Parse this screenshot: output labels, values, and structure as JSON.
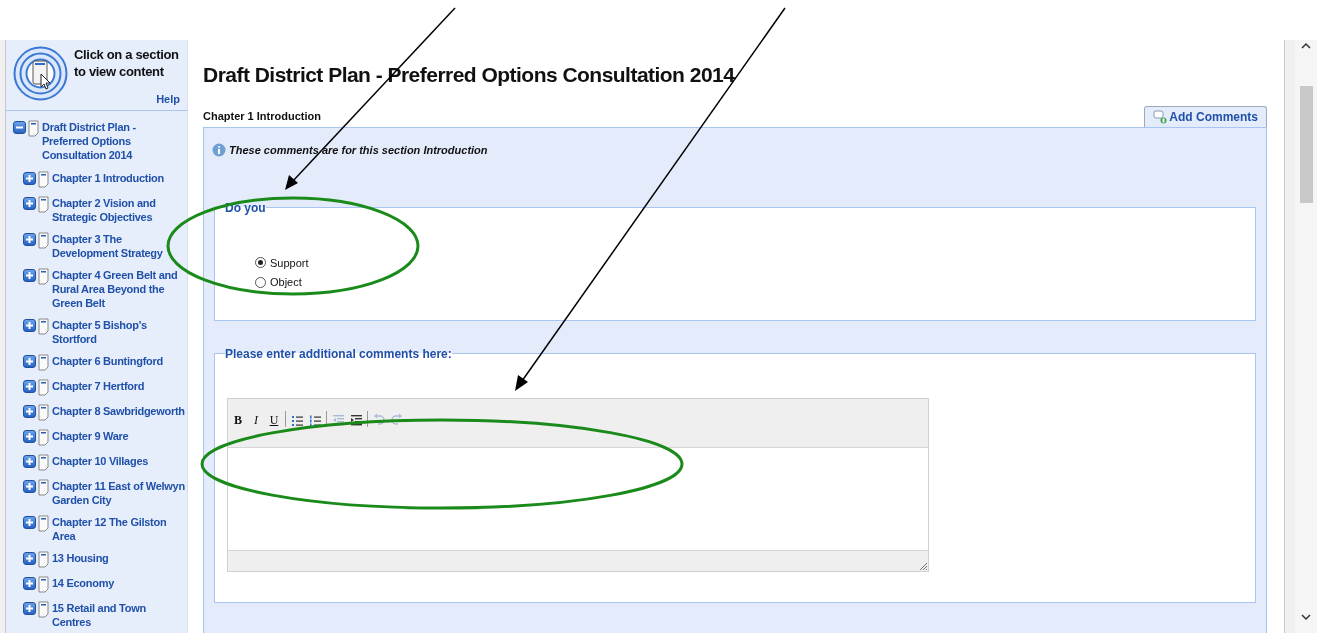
{
  "sidebar": {
    "header": {
      "prompt": "Click on a section to view content",
      "help": "Help"
    },
    "tree": {
      "label": "Draft District Plan - Preferred Options Consultation 2014",
      "expanded": true,
      "children": [
        {
          "label": "Chapter 1 Introduction",
          "expanded": false
        },
        {
          "label": "Chapter 2 Vision and Strategic Objectives",
          "expanded": false
        },
        {
          "label": "Chapter 3 The Development Strategy",
          "expanded": false
        },
        {
          "label": "Chapter 4 Green Belt and Rural Area Beyond the Green Belt",
          "expanded": false
        },
        {
          "label": "Chapter 5 Bishop's Stortford",
          "expanded": false
        },
        {
          "label": "Chapter 6 Buntingford",
          "expanded": false
        },
        {
          "label": "Chapter 7 Hertford",
          "expanded": false
        },
        {
          "label": "Chapter 8 Sawbridgeworth",
          "expanded": false
        },
        {
          "label": "Chapter 9 Ware",
          "expanded": false
        },
        {
          "label": "Chapter 10 Villages",
          "expanded": false
        },
        {
          "label": "Chapter 11 East of Welwyn Garden City",
          "expanded": false
        },
        {
          "label": "Chapter 12 The Gilston Area",
          "expanded": false
        },
        {
          "label": "13 Housing",
          "expanded": false
        },
        {
          "label": "14 Economy",
          "expanded": false
        },
        {
          "label": "15 Retail and Town Centres",
          "expanded": false
        }
      ]
    }
  },
  "main": {
    "title": "Draft District Plan - Preferred Options Consultation 2014",
    "section": "Chapter 1 Introduction",
    "tab": {
      "label": "Add Comments",
      "selected": true
    },
    "info": "These comments are for this section Introduction",
    "question": {
      "legend": "Do you",
      "options": [
        {
          "label": "Support",
          "selected": true
        },
        {
          "label": "Object",
          "selected": false
        }
      ]
    },
    "comments": {
      "legend": "Please enter additional comments here:",
      "toolbar": [
        {
          "kind": "bold",
          "label": "B",
          "disabled": false
        },
        {
          "kind": "italic",
          "label": "I",
          "disabled": false
        },
        {
          "kind": "underline",
          "label": "U",
          "disabled": false
        },
        {
          "kind": "separator"
        },
        {
          "kind": "bullets",
          "disabled": false
        },
        {
          "kind": "numbers",
          "disabled": false
        },
        {
          "kind": "separator"
        },
        {
          "kind": "outdent",
          "disabled": true
        },
        {
          "kind": "indent",
          "disabled": false
        },
        {
          "kind": "separator"
        },
        {
          "kind": "undo",
          "disabled": true
        },
        {
          "kind": "redo",
          "disabled": true
        }
      ]
    }
  }
}
